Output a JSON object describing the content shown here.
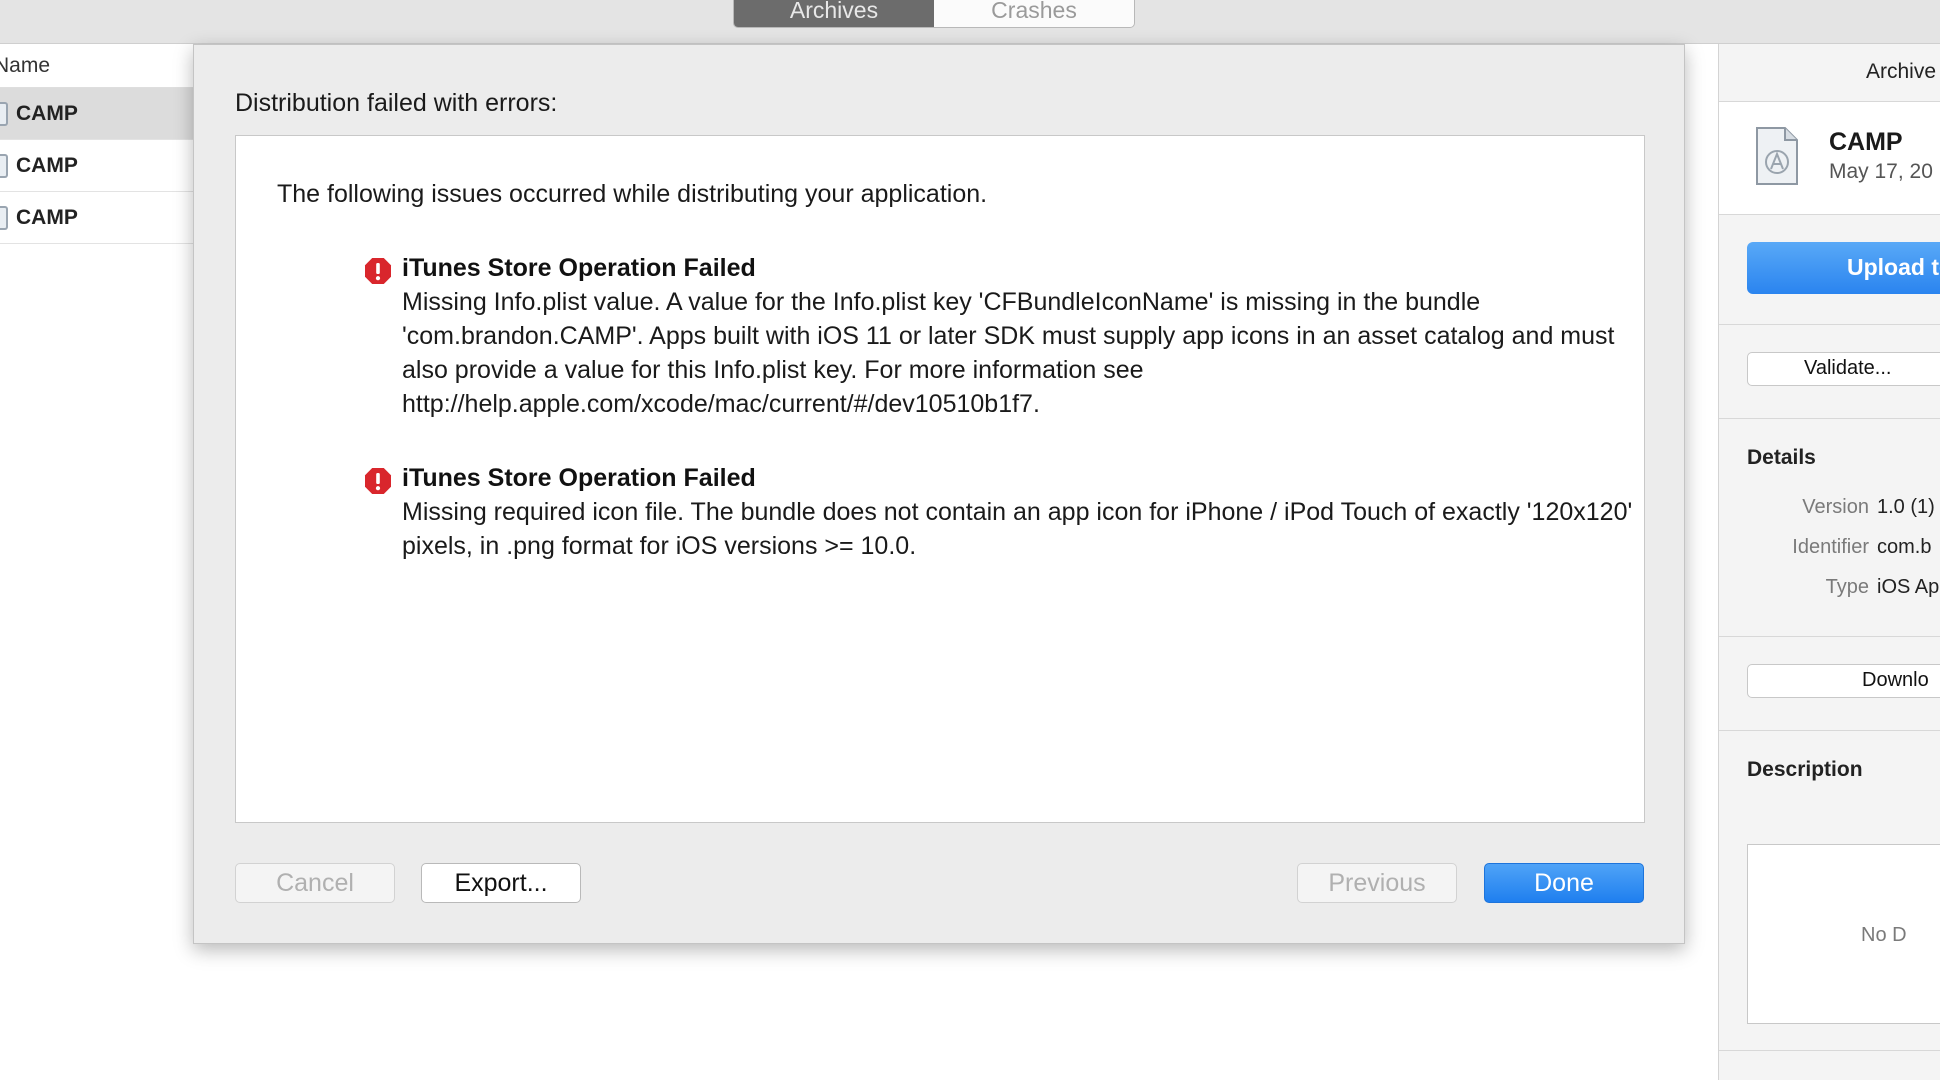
{
  "toolbar": {
    "segments": [
      {
        "label": "Archives",
        "active": true
      },
      {
        "label": "Crashes",
        "active": false
      }
    ]
  },
  "archive_list": {
    "column_header": "Name",
    "rows": [
      {
        "name": "CAMP",
        "selected": true
      },
      {
        "name": "CAMP",
        "selected": false
      },
      {
        "name": "CAMP",
        "selected": false
      }
    ]
  },
  "inspector": {
    "title": "Archive",
    "archive_name": "CAMP",
    "archive_date": "May 17, 20",
    "upload_button": "Upload to",
    "validate_button": "Validate...",
    "details_heading": "Details",
    "details": [
      {
        "key": "Version",
        "value": "1.0 (1)"
      },
      {
        "key": "Identifier",
        "value": "com.b"
      },
      {
        "key": "Type",
        "value": "iOS Ap"
      }
    ],
    "download_button": "Downlo",
    "description_heading": "Description",
    "description_empty": "No D"
  },
  "sheet": {
    "title": "Distribution failed with errors:",
    "intro": "The following issues occurred while distributing your application.",
    "issues": [
      {
        "title": "iTunes Store Operation Failed",
        "body": "Missing Info.plist value. A value for the Info.plist key 'CFBundleIconName' is missing in the bundle 'com.brandon.CAMP'. Apps built with iOS 11 or later SDK must supply app icons in an asset catalog and must also provide a value for this Info.plist key. For more information see http://help.apple.com/xcode/mac/current/#/dev10510b1f7."
      },
      {
        "title": "iTunes Store Operation Failed",
        "body": "Missing required icon file. The bundle does not contain an app icon for iPhone / iPod Touch of exactly '120x120' pixels, in .png format for iOS versions >= 10.0."
      }
    ],
    "buttons": {
      "cancel": "Cancel",
      "export": "Export...",
      "previous": "Previous",
      "done": "Done"
    }
  },
  "colors": {
    "accent": "#2a84ef",
    "error": "#d9262c"
  }
}
